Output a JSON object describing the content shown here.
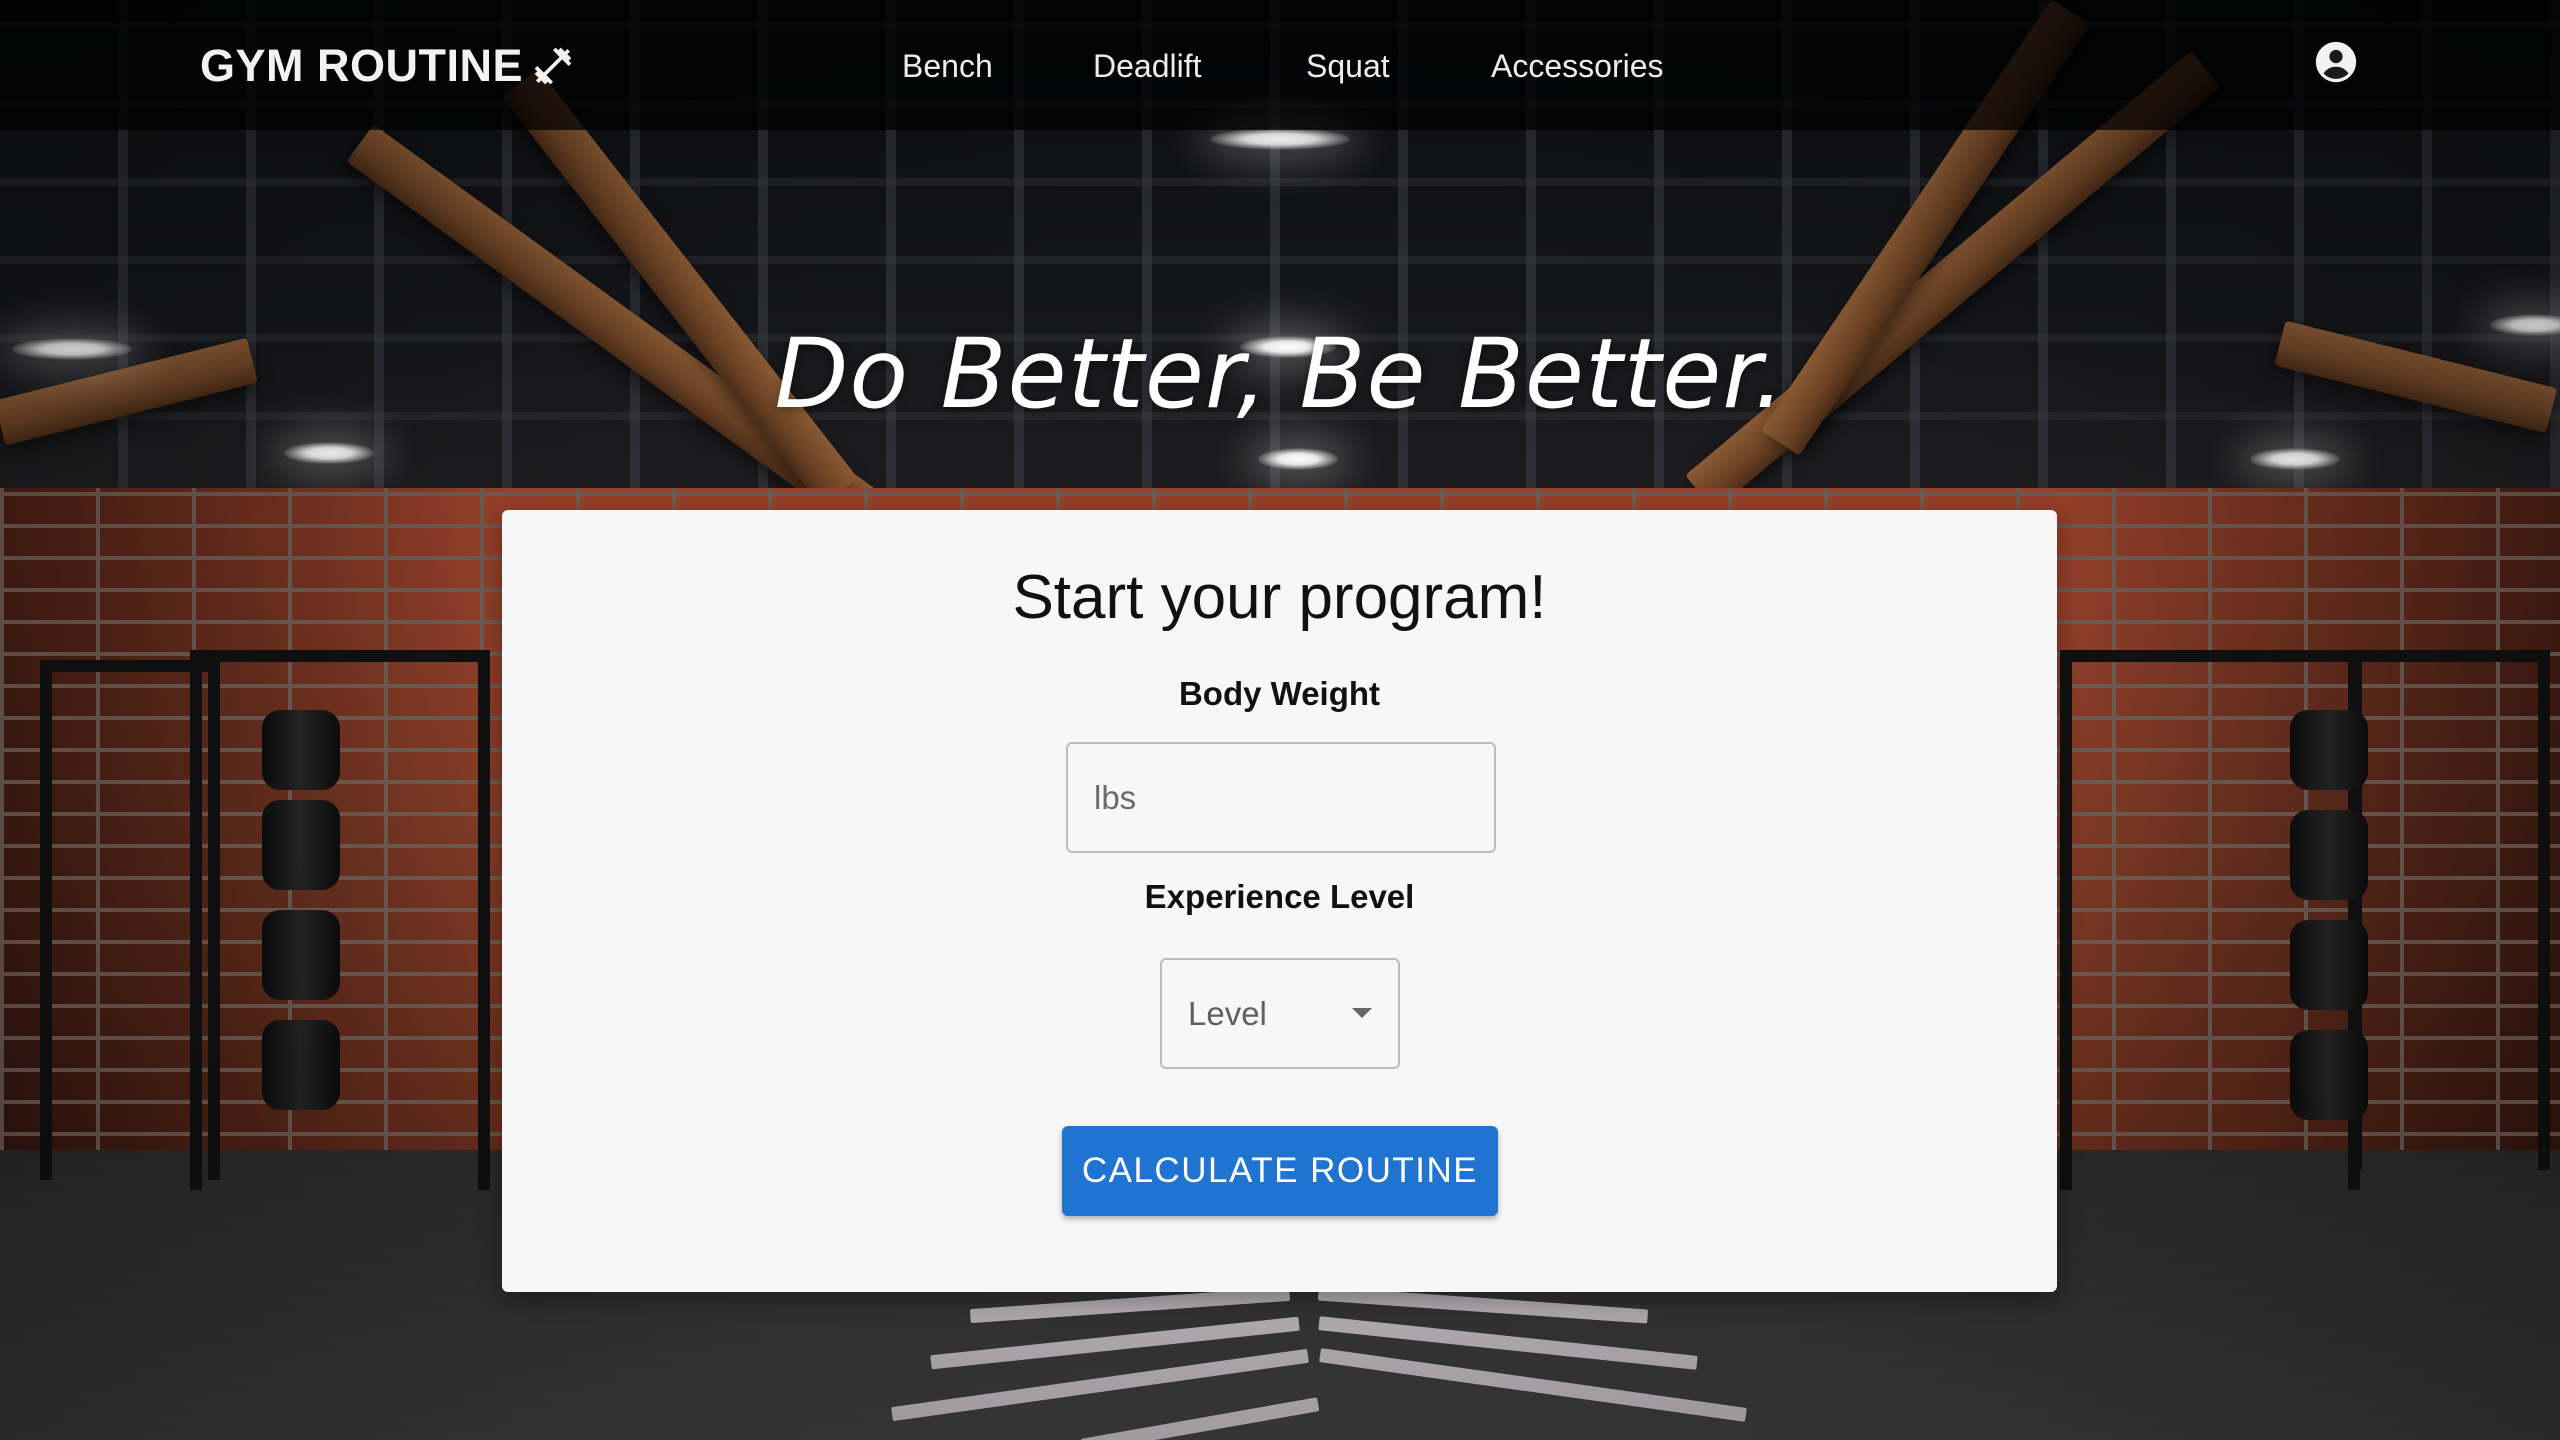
{
  "header": {
    "brand": "GYM ROUTINE",
    "brand_icon": "dumbbell-icon",
    "nav": [
      {
        "label": "Bench"
      },
      {
        "label": "Deadlift"
      },
      {
        "label": "Squat"
      },
      {
        "label": "Accessories"
      }
    ],
    "account_icon": "account-circle-icon"
  },
  "hero": {
    "tagline": "Do Better, Be Better."
  },
  "form": {
    "title": "Start your program!",
    "body_weight": {
      "label": "Body Weight",
      "value": "",
      "placeholder": "lbs"
    },
    "experience": {
      "label": "Experience Level",
      "selected": "Level"
    },
    "submit_label": "CALCULATE ROUTINE"
  },
  "colors": {
    "primary_button": "#1f74d1",
    "card_background": "#f7f7f7",
    "header_background": "#000000"
  }
}
